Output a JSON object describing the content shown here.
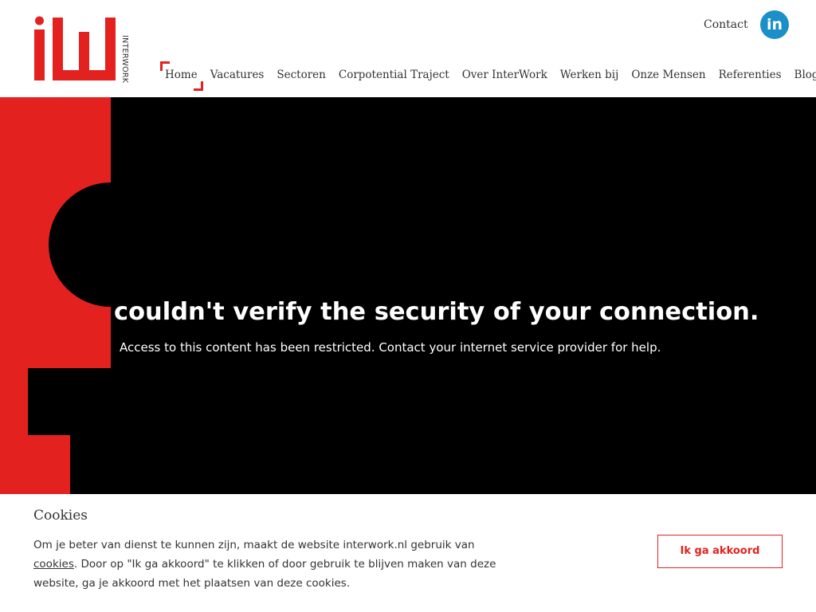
{
  "colors": {
    "brand_red": "#e3221f",
    "linkedin_blue": "#1b8fc7",
    "hero_bg": "#000000"
  },
  "header": {
    "logo_letters": "iW",
    "logo_sub": "INTERWORK",
    "contact_label": "Contact",
    "linkedin_glyph": "in",
    "linkedin_icon": "linkedin-icon"
  },
  "nav": {
    "items": [
      {
        "label": "Home",
        "active": true
      },
      {
        "label": "Vacatures"
      },
      {
        "label": "Sectoren"
      },
      {
        "label": "Corpotential Traject"
      },
      {
        "label": "Over InterWork"
      },
      {
        "label": "Werken bij"
      },
      {
        "label": "Onze Mensen"
      },
      {
        "label": "Referenties"
      },
      {
        "label": "Blog"
      }
    ]
  },
  "hero": {
    "title": "couldn't verify the security of your connection.",
    "subtitle": "Access to this content has been restricted. Contact your internet service provider for help."
  },
  "cookie": {
    "title": "Cookies",
    "text_before": "Om je beter van dienst te kunnen zijn, maakt de website interwork.nl gebruik van ",
    "link_label": "cookies",
    "text_after": ". Door op \"Ik ga akkoord\" te klikken of door gebruik te blijven maken van deze website, ga je akkoord met het plaatsen van deze cookies.",
    "accept_label": "Ik ga akkoord"
  }
}
